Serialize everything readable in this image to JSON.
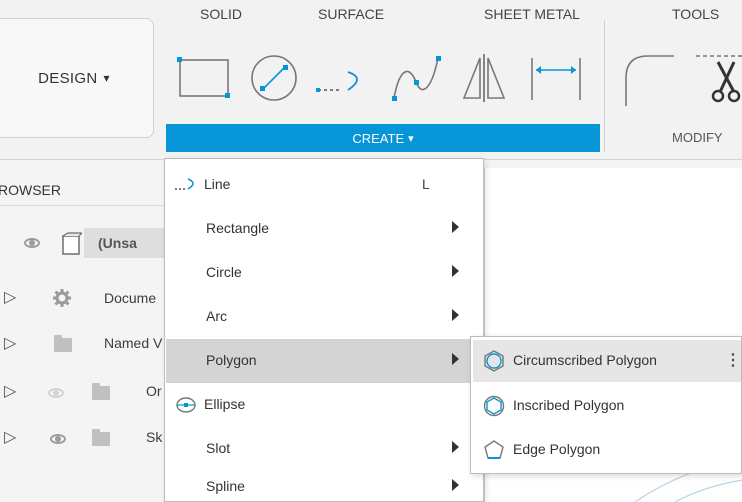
{
  "toolbar": {
    "design_label": "DESIGN",
    "design_dropdown_glyph": "▾",
    "tabs": [
      "SOLID",
      "SURFACE",
      "SHEET METAL",
      "TOOLS"
    ],
    "create_label": "CREATE",
    "create_dropdown_glyph": "▾",
    "modify_label": "MODIFY",
    "tool_icons": [
      "rectangle-icon",
      "circle-icon",
      "line-icon",
      "spline-icon",
      "mirror-icon",
      "dimension-icon",
      "fillet-icon",
      "trim-scissors-icon"
    ],
    "accent_color": "#0696d7"
  },
  "browser": {
    "title": "ROWSER",
    "items": [
      {
        "label": "(Unsa",
        "icon": "component-icon"
      },
      {
        "label": "Docume",
        "icon": "gear-icon"
      },
      {
        "label": "Named V",
        "icon": "folder-icon"
      },
      {
        "label": "Or",
        "icon": "folder-icon"
      },
      {
        "label": "Sk",
        "icon": "folder-icon"
      }
    ]
  },
  "create_menu": {
    "items": [
      {
        "label": "Line",
        "shortcut": "L",
        "icon": "line-icon"
      },
      {
        "label": "Rectangle"
      },
      {
        "label": "Circle"
      },
      {
        "label": "Arc"
      },
      {
        "label": "Polygon"
      },
      {
        "label": "Ellipse",
        "icon": "ellipse-icon"
      },
      {
        "label": "Slot"
      },
      {
        "label": "Spline"
      }
    ]
  },
  "polygon_submenu": {
    "items": [
      {
        "label": "Circumscribed Polygon",
        "icon": "circumscribed-polygon-icon"
      },
      {
        "label": "Inscribed Polygon",
        "icon": "inscribed-polygon-icon"
      },
      {
        "label": "Edge Polygon",
        "icon": "edge-polygon-icon"
      }
    ],
    "more_glyph": "⋮"
  }
}
